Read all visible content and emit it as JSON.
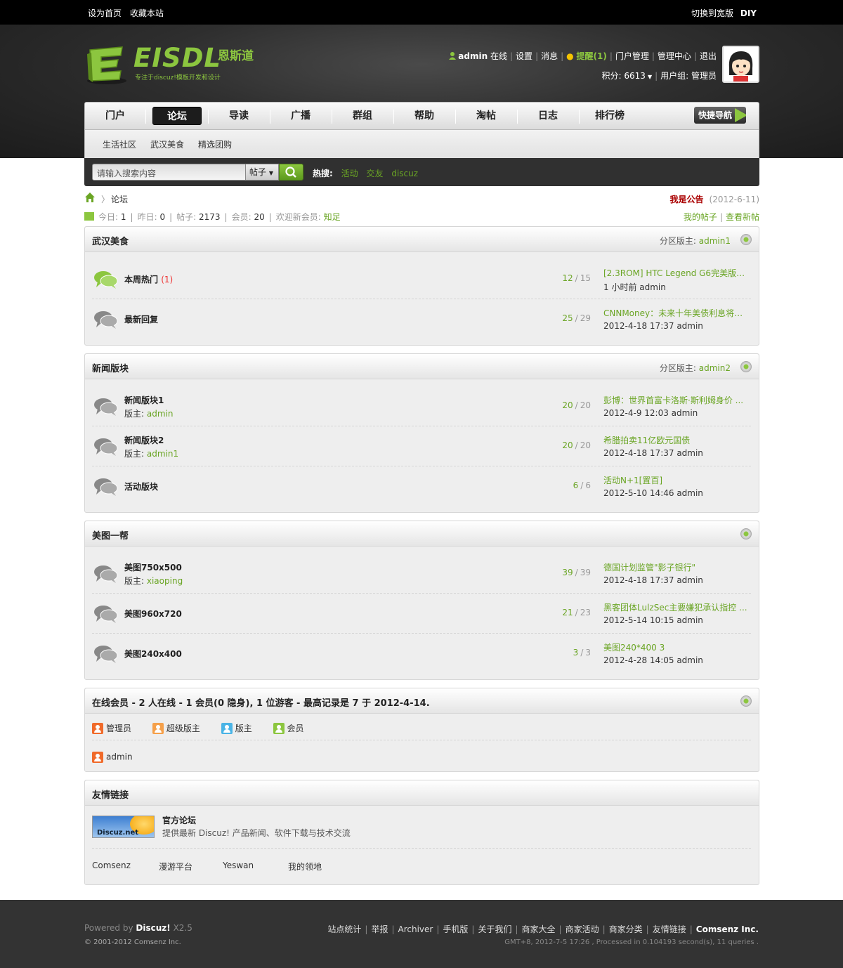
{
  "topbar": {
    "set_home": "设为首页",
    "favorite": "收藏本站",
    "switch_width": "切换到宽版",
    "diy": "DIY"
  },
  "logo": {
    "text": "EISDL",
    "cn": "恩斯道",
    "tagline": "专注于discuz!模板开发和设计"
  },
  "user": {
    "name": "admin",
    "status": "在线",
    "settings": "设置",
    "messages": "消息",
    "remind": "提醒(1)",
    "portal_admin": "门户管理",
    "admin_center": "管理中心",
    "logout": "退出",
    "credits_label": "积分: 6613",
    "group_label": "用户组: 管理员"
  },
  "nav": [
    "门户",
    "论坛",
    "导读",
    "广播",
    "群组",
    "帮助",
    "淘帖",
    "日志",
    "排行榜"
  ],
  "quicknav": "快捷导航",
  "subnav": [
    "生活社区",
    "武汉美食",
    "精选团购"
  ],
  "search": {
    "placeholder": "请输入搜索内容",
    "type": "帖子",
    "hot_label": "热搜:",
    "hot": [
      "活动",
      "交友",
      "discuz"
    ]
  },
  "breadcrumb": {
    "current": "论坛",
    "notice": "我是公告",
    "notice_date": "(2012-6-11)"
  },
  "stats": {
    "today_label": "今日:",
    "today": "1",
    "yesterday_label": "昨日:",
    "yesterday": "0",
    "posts_label": "帖子:",
    "posts": "2173",
    "members_label": "会员:",
    "members": "20",
    "welcome_label": "欢迎新会员:",
    "newest": "知足",
    "my_posts": "我的帖子",
    "view_new": "查看新帖"
  },
  "mod_label": "分区版主:",
  "moderator_label": "版主:",
  "categories": [
    {
      "title": "武汉美食",
      "moderator": "admin1",
      "forums": [
        {
          "name": "本周热门",
          "new": "(1)",
          "threads": "12",
          "posts": "15",
          "last_title": "[2.3ROM] HTC Legend G6完美版本 ...",
          "last_time": "1 小时前 admin",
          "hot": true
        },
        {
          "name": "最新回复",
          "threads": "25",
          "posts": "29",
          "last_title": "CNNMoney：未来十年美债利息将达 ...",
          "last_time": "2012-4-18 17:37 admin"
        }
      ]
    },
    {
      "title": "新闻版块",
      "moderator": "admin2",
      "forums": [
        {
          "name": "新闻版块1",
          "mod": "admin",
          "threads": "20",
          "posts": "20",
          "last_title": "彭博：世界首富卡洛斯·斯利姆身价 ...",
          "last_time": "2012-4-9 12:03 admin"
        },
        {
          "name": "新闻版块2",
          "mod": "admin1",
          "threads": "20",
          "posts": "20",
          "last_title": "希腊拍卖11亿欧元国债",
          "last_time": "2012-4-18 17:37 admin"
        },
        {
          "name": "活动版块",
          "threads": "6",
          "posts": "6",
          "last_title": "活动N+1[置百]",
          "last_time": "2012-5-10 14:46 admin"
        }
      ]
    },
    {
      "title": "美图一帮",
      "moderator": "",
      "forums": [
        {
          "name": "美图750x500",
          "mod": "xiaoping",
          "threads": "39",
          "posts": "39",
          "last_title": "德国计划监管\"影子银行\"",
          "last_time": "2012-4-18 17:37 admin"
        },
        {
          "name": "美图960x720",
          "threads": "21",
          "posts": "23",
          "last_title": "黑客团体LulzSec主要嫌犯承认指控 ...",
          "last_time": "2012-5-14 10:15 admin"
        },
        {
          "name": "美图240x400",
          "threads": "3",
          "posts": "3",
          "last_title": "美图240*400 3",
          "last_time": "2012-4-28 14:05 admin"
        }
      ]
    }
  ],
  "online": {
    "title": "在线会员 - 2 人在线 - 1 会员(0 隐身), 1 位游客 - 最高记录是 7 于 2012-4-14.",
    "legend": [
      {
        "label": "管理员",
        "color": "#f06a2a"
      },
      {
        "label": "超级版主",
        "color": "#f5a04a"
      },
      {
        "label": "版主",
        "color": "#4ab4e6"
      },
      {
        "label": "会员",
        "color": "#8cc63f"
      }
    ],
    "users": [
      "admin"
    ]
  },
  "links": {
    "title": "友情链接",
    "official_name": "官方论坛",
    "official_desc": "提供最新 Discuz! 产品新闻、软件下载与技术交流",
    "logo_text": "Discuz.net",
    "text_links": [
      "Comsenz",
      "漫游平台",
      "Yeswan",
      "我的领地"
    ]
  },
  "footer": {
    "powered": "Powered by",
    "brand": "Discuz!",
    "version": "X2.5",
    "copyright": "© 2001-2012 Comsenz Inc.",
    "links": [
      "站点统计",
      "举报",
      "Archiver",
      "手机版",
      "关于我们",
      "商家大全",
      "商家活动",
      "商家分类",
      "友情链接"
    ],
    "company": "Comsenz Inc.",
    "gmt": "GMT+8, 2012-7-5 17:26 , Processed in 0.104193 second(s), 11 queries ."
  }
}
